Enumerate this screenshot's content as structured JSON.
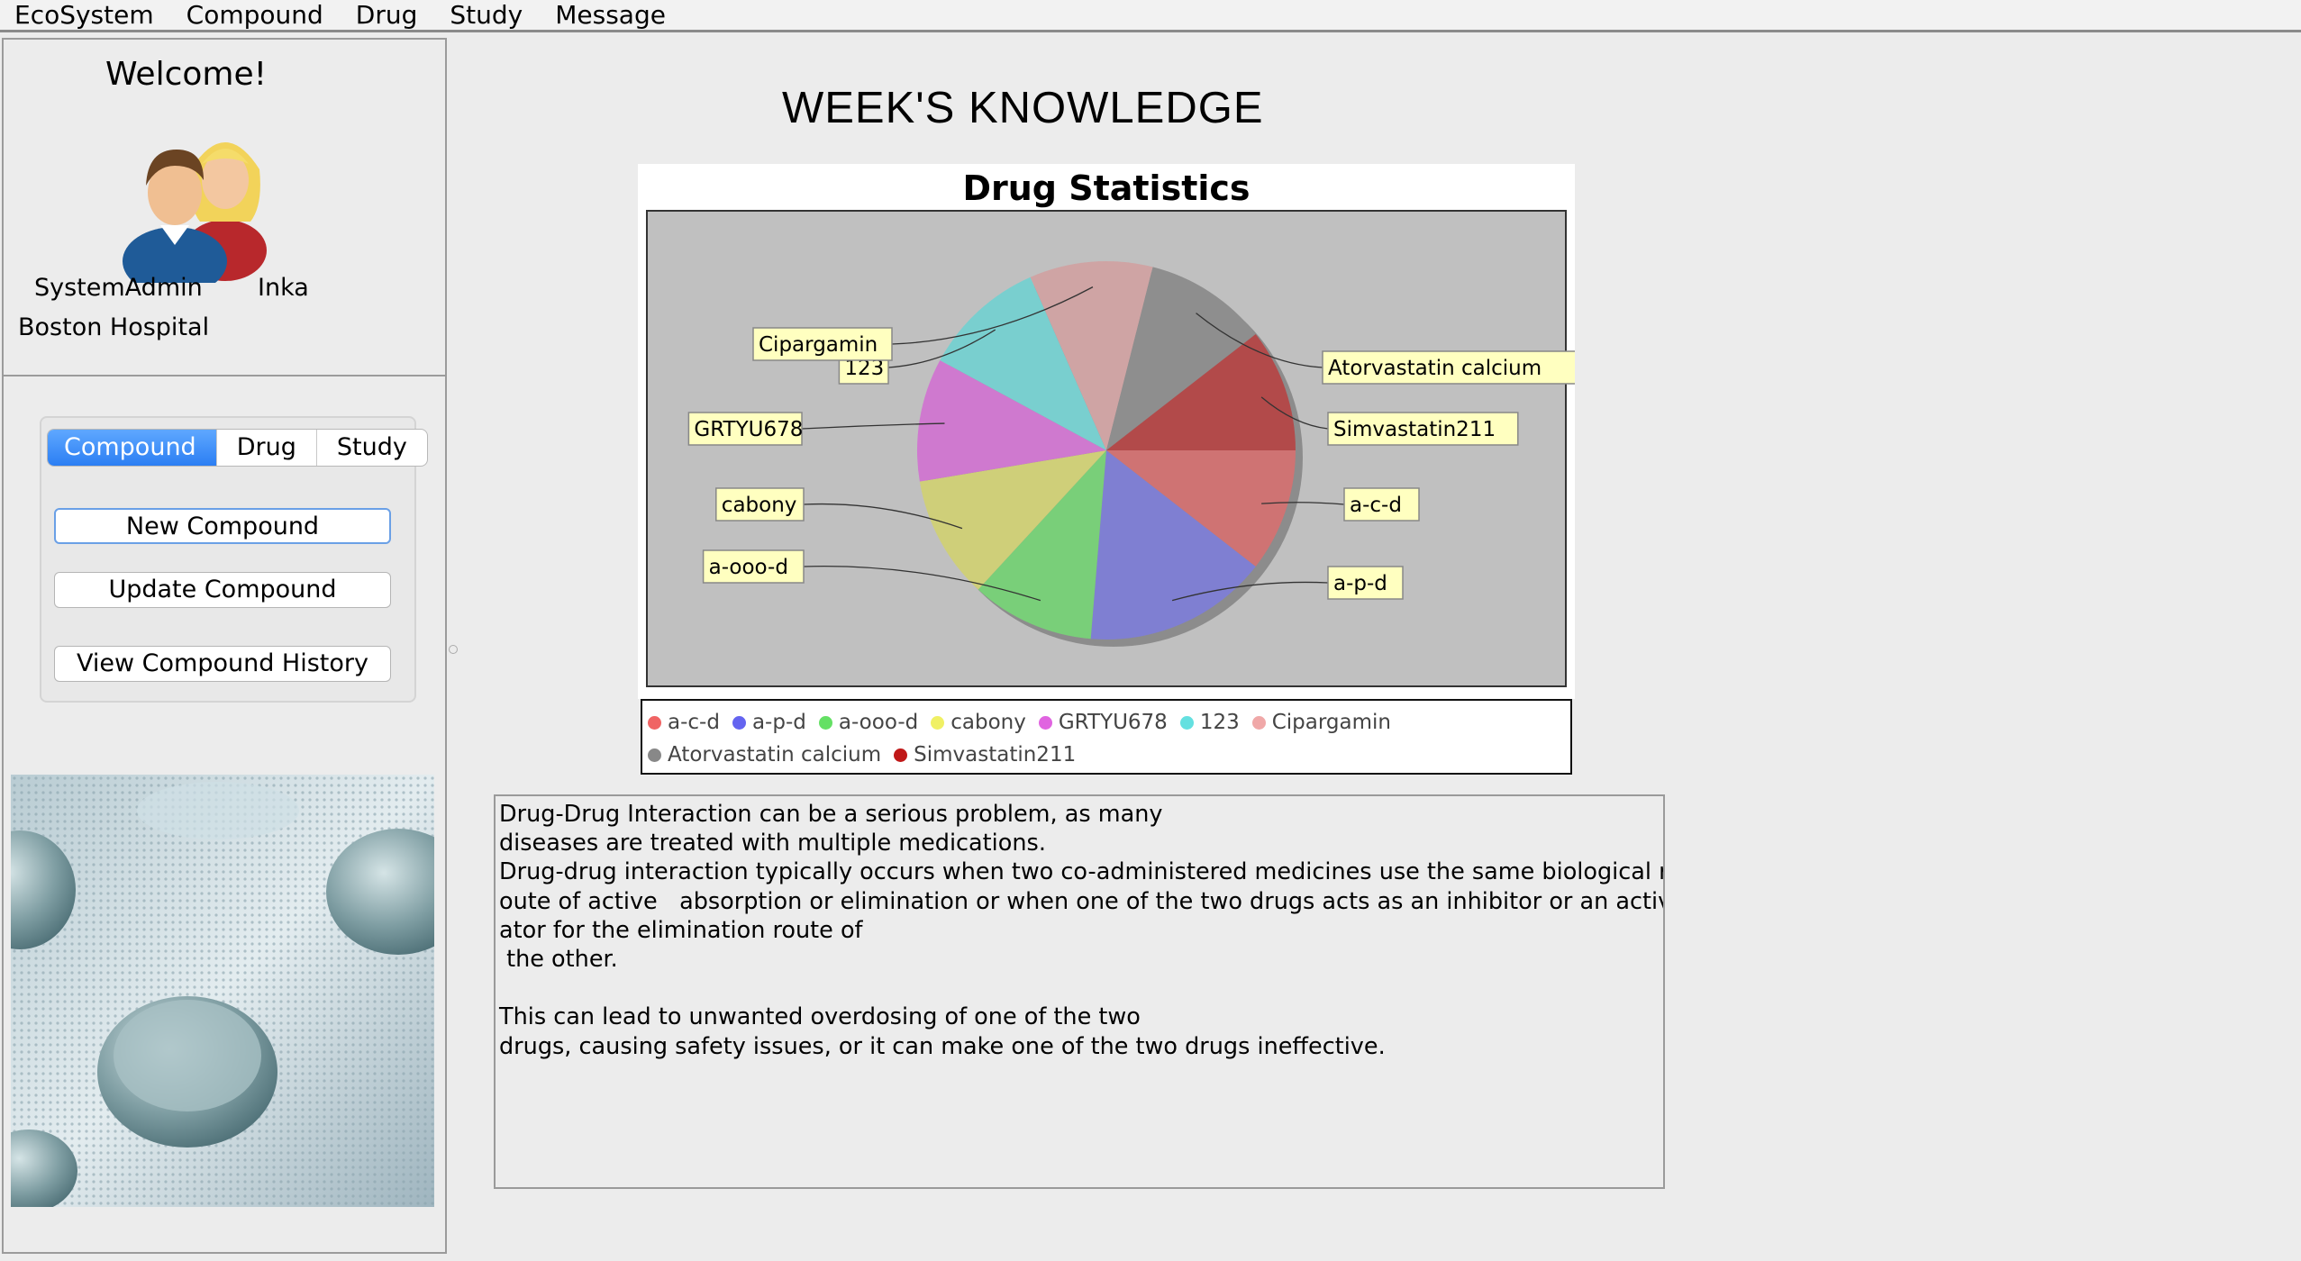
{
  "menubar": {
    "items": [
      "EcoSystem",
      "Compound",
      "Drug",
      "Study",
      "Message"
    ]
  },
  "sidebar": {
    "welcome": "Welcome!",
    "role": "SystemAdmin",
    "username": "Inka",
    "organization": "Boston Hospital",
    "tabs": [
      {
        "label": "Compound",
        "active": true
      },
      {
        "label": "Drug",
        "active": false
      },
      {
        "label": "Study",
        "active": false
      }
    ],
    "buttons": {
      "new": "New Compound",
      "update": "Update Compound",
      "history": "View Compound History"
    }
  },
  "main": {
    "title": "WEEK'S KNOWLEDGE",
    "info_text": "Drug-Drug Interaction can be a serious problem, as many\ndiseases are treated with multiple medications.\nDrug-drug interaction typically occurs when two co-administered medicines use the same biological r\noute of active   absorption or elimination or when one of the two drugs acts as an inhibitor or an activ\nator for the elimination route of\n the other.\n\nThis can lead to unwanted overdosing of one of the two\ndrugs, causing safety issues, or it can make one of the two drugs ineffective."
  },
  "colors": {
    "accent": "#2b7ef3",
    "plot_background": "#c0c0c0"
  },
  "chart_data": {
    "type": "pie",
    "title": "Drug Statistics",
    "slices": [
      {
        "label": "a-c-d",
        "value": 1,
        "color": "#cf7373"
      },
      {
        "label": "a-p-d",
        "value": 1.5,
        "color": "#7f7fd2"
      },
      {
        "label": "a-ooo-d",
        "value": 1,
        "color": "#79cf79"
      },
      {
        "label": "cabony",
        "value": 1,
        "color": "#cfcf79"
      },
      {
        "label": "GRTYU678",
        "value": 1,
        "color": "#cf79cf"
      },
      {
        "label": "123",
        "value": 1,
        "color": "#79cfcf"
      },
      {
        "label": "Cipargamin",
        "value": 1,
        "color": "#cfa4a4"
      },
      {
        "label": "Atorvastatin calcium",
        "value": 1,
        "color": "#8e8e8e"
      },
      {
        "label": "Simvastatin211",
        "value": 1,
        "color": "#b24a4a"
      }
    ],
    "legend_dots": [
      "#f06464",
      "#6464f0",
      "#64e064",
      "#f0f064",
      "#e064e0",
      "#64e0e0",
      "#f0a8a8",
      "#888888",
      "#c01818"
    ],
    "legend_position": "bottom"
  }
}
